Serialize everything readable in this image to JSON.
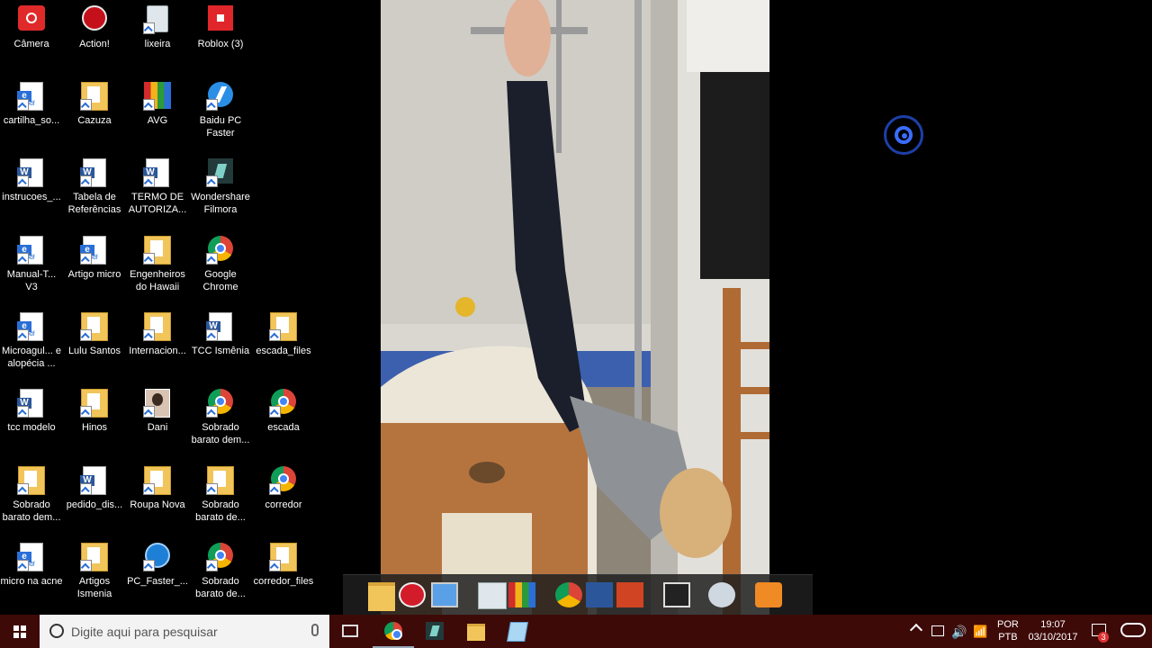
{
  "desktop": {
    "icons": [
      {
        "label": "Câmera",
        "type": "camera"
      },
      {
        "label": "Action!",
        "type": "action"
      },
      {
        "label": "lixeira",
        "type": "recycle"
      },
      {
        "label": "Roblox (3)",
        "type": "roblox"
      },
      {
        "label": "cartilha_so...",
        "type": "pdf"
      },
      {
        "label": "Cazuza",
        "type": "folder"
      },
      {
        "label": "AVG",
        "type": "avg"
      },
      {
        "label": "Baidu PC Faster",
        "type": "baidu"
      },
      {
        "label": "instrucoes_...",
        "type": "word"
      },
      {
        "label": "Tabela de Referências",
        "type": "word"
      },
      {
        "label": "TERMO DE AUTORIZA...",
        "type": "word"
      },
      {
        "label": "Wondershare Filmora",
        "type": "filmora"
      },
      {
        "label": "Manual-T... V3",
        "type": "pdf"
      },
      {
        "label": "Artigo micro",
        "type": "pdf"
      },
      {
        "label": "Engenheiros do Hawaii",
        "type": "folder"
      },
      {
        "label": "Google Chrome",
        "type": "chrome"
      },
      {
        "label": "Microagul... e alopécia ...",
        "type": "pdf"
      },
      {
        "label": "Lulu Santos",
        "type": "folder"
      },
      {
        "label": "Internacion...",
        "type": "folder"
      },
      {
        "label": "TCC Ismênia",
        "type": "word"
      },
      {
        "label": "escada_files",
        "type": "folder"
      },
      {
        "label": "tcc modelo",
        "type": "word"
      },
      {
        "label": "Hinos",
        "type": "folder"
      },
      {
        "label": "Dani",
        "type": "photo"
      },
      {
        "label": "Sobrado barato dem...",
        "type": "chrome"
      },
      {
        "label": "escada",
        "type": "chrome"
      },
      {
        "label": "Sobrado barato dem...",
        "type": "folder"
      },
      {
        "label": "pedido_dis...",
        "type": "word"
      },
      {
        "label": "Roupa Nova",
        "type": "folder"
      },
      {
        "label": "Sobrado barato de...",
        "type": "folder"
      },
      {
        "label": "corredor",
        "type": "chrome"
      },
      {
        "label": "micro na acne",
        "type": "pdf"
      },
      {
        "label": "Artigos Ismenia",
        "type": "folder"
      },
      {
        "label": "PC_Faster_...",
        "type": "pcfaster"
      },
      {
        "label": "Sobrado barato de...",
        "type": "chrome"
      },
      {
        "label": "corredor_files",
        "type": "folder"
      }
    ]
  },
  "dock": {
    "items": [
      "file-explorer",
      "record",
      "computer",
      "recycle-bin",
      "avg",
      "chrome",
      "word",
      "powerpoint",
      "media-player-classic",
      "paint",
      "video-player"
    ]
  },
  "taskbar": {
    "search_placeholder": "Digite aqui para pesquisar",
    "apps": [
      "chrome",
      "filmora",
      "file-explorer",
      "notepad"
    ],
    "lang_top": "POR",
    "lang_bottom": "PTB",
    "time": "19:07",
    "date": "03/10/2017",
    "notifications": "3"
  },
  "colors": {
    "taskbar_bg": "#3d0a08",
    "desktop_bg": "#000000",
    "accent": "#3a6cff"
  }
}
